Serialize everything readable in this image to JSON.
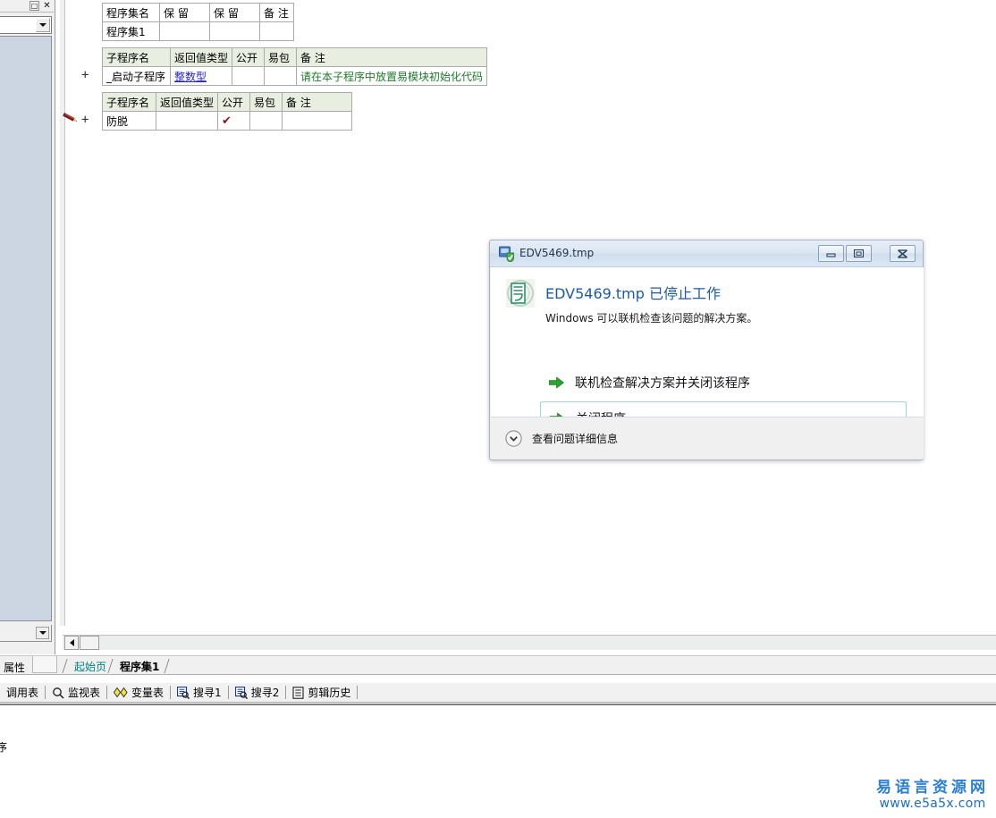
{
  "left_dock": {
    "restore_label": "□",
    "close_label": "✕",
    "combo_value": "",
    "bottom_combo_value": ""
  },
  "gutter": {
    "expand_marker_1": "+",
    "expand_marker_2": "+",
    "pencil_icon": "pencil-icon"
  },
  "editor": {
    "program_set_table": {
      "headers": [
        "程序集名",
        "保 留",
        "保 留",
        "备 注"
      ],
      "rows": [
        [
          "程序集1",
          "",
          "",
          ""
        ]
      ]
    },
    "startup_table": {
      "headers": [
        "子程序名",
        "返回值类型",
        "公开",
        "易包",
        "备 注"
      ],
      "rows": [
        {
          "name": "_启动子程序",
          "return_type": "整数型",
          "public": "",
          "package": "",
          "remark": "请在本子程序中放置易模块初始化代码"
        }
      ]
    },
    "sub_table": {
      "headers": [
        "子程序名",
        "返回值类型",
        "公开",
        "易包",
        "备 注"
      ],
      "rows": [
        {
          "name": "防脱",
          "return_type": "",
          "public": "✔",
          "package": "",
          "remark": ""
        }
      ]
    }
  },
  "tabstrip": {
    "properties_label": "属性",
    "tabs": [
      {
        "label": "起始页",
        "active": false
      },
      {
        "label": "程序集1",
        "active": true
      }
    ]
  },
  "toolstrip": {
    "items": [
      {
        "label": "调用表",
        "icon": ""
      },
      {
        "label": "监视表",
        "icon": "search-icon"
      },
      {
        "label": "变量表",
        "icon": "diamond-icon"
      },
      {
        "label": "搜寻1",
        "icon": "find-icon"
      },
      {
        "label": "搜寻2",
        "icon": "find-icon"
      },
      {
        "label": "剪辑历史",
        "icon": "clipboard-icon"
      }
    ]
  },
  "output_pane": {
    "clipped_text": "序"
  },
  "watermark": {
    "cn": "易语言资源网",
    "url": "www.e5a5x.com",
    "color": "#2a7fd4"
  },
  "crash_dialog": {
    "title": "EDV5469.tmp",
    "title_icon": "app-shield-icon",
    "window_buttons": {
      "minimize": "minimize-icon",
      "maximize": "maximize-icon",
      "close": "close-icon"
    },
    "app_icon": "yi-language-icon",
    "heading": "EDV5469.tmp 已停止工作",
    "subtext": "Windows 可以联机检查该问题的解决方案。",
    "actions": [
      {
        "label": "联机检查解决方案并关闭该程序",
        "highlighted": false
      },
      {
        "label": "关闭程序",
        "highlighted": true
      }
    ],
    "footer_label": "查看问题详细信息",
    "heading_color": "#1e5aa8",
    "arrow_color": "#2a9b2a"
  }
}
